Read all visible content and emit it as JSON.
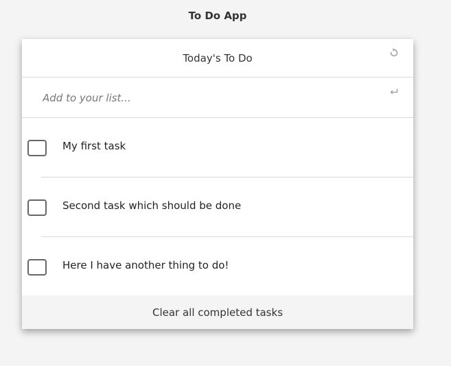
{
  "app": {
    "title": "To Do App"
  },
  "card": {
    "heading": "Today's To Do",
    "refresh_icon": "refresh-icon",
    "add_input": {
      "value": "",
      "placeholder": "Add to your list..."
    },
    "enter_icon": "enter-return-icon",
    "tasks": [
      {
        "label": "My first task",
        "checked": false
      },
      {
        "label": "Second task which should be done",
        "checked": false
      },
      {
        "label": "Here I have another thing to do!",
        "checked": false
      }
    ],
    "clear_label": "Clear all completed tasks"
  },
  "colors": {
    "background": "#f4f4f4",
    "card": "#ffffff",
    "divider": "#d9d9d9",
    "checkbox_border": "#666666"
  }
}
